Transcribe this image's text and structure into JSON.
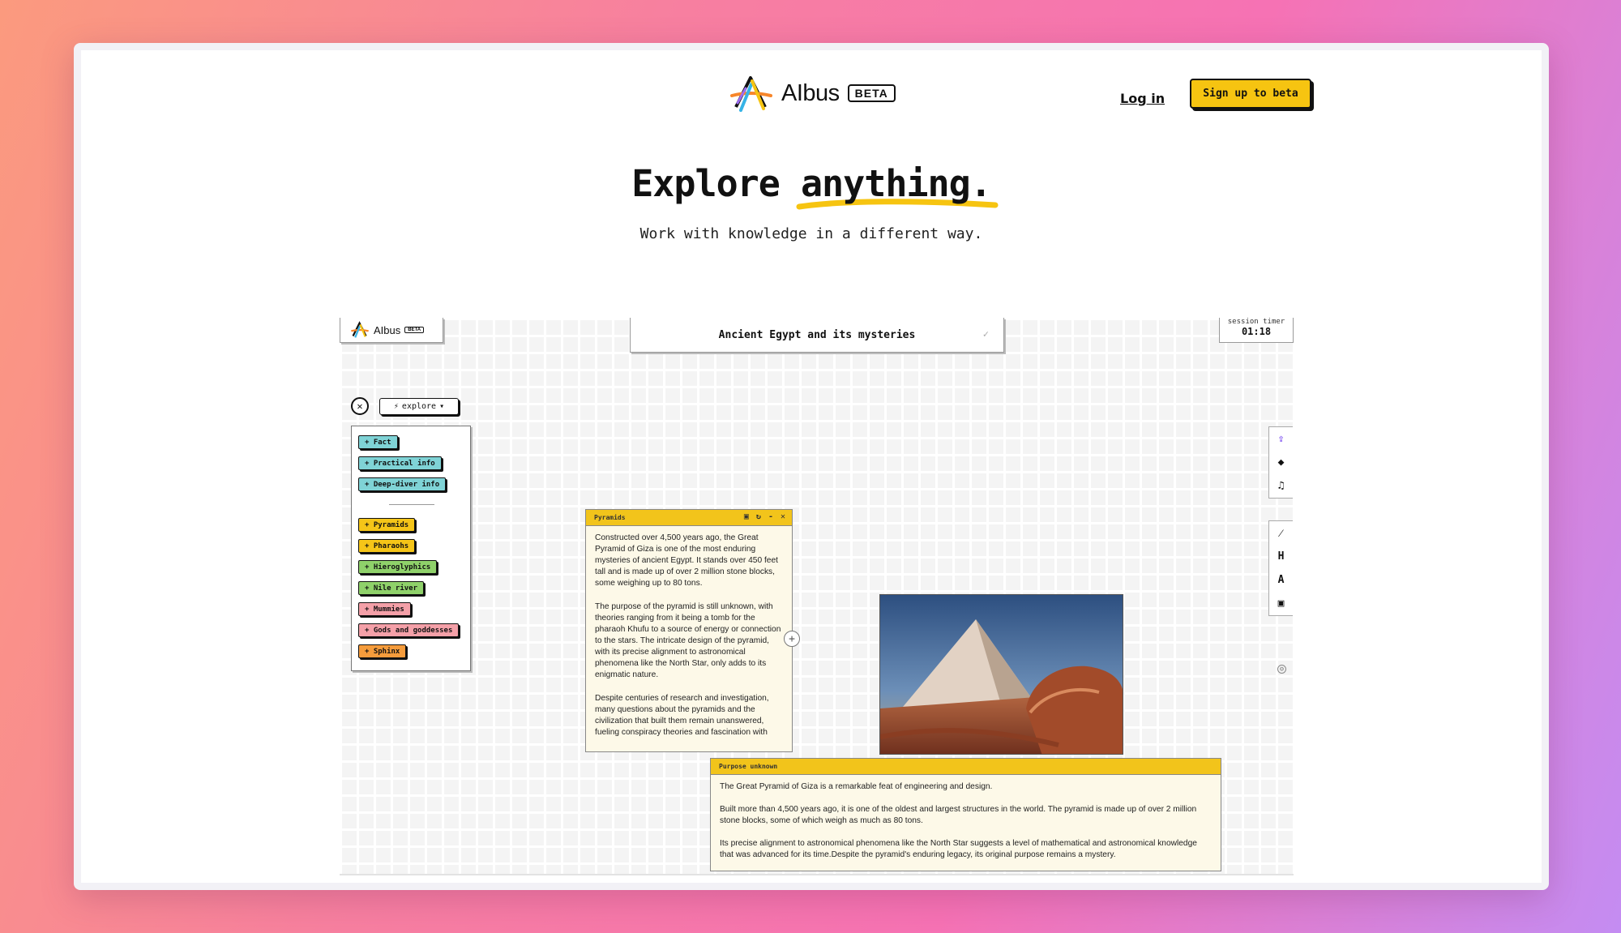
{
  "header": {
    "logo_text": "AIbus",
    "beta_label": "BETA",
    "login_label": "Log in",
    "signup_label": "Sign up to beta"
  },
  "hero": {
    "title_prefix": "Explore",
    "title_highlight": "anything.",
    "subtitle": "Work with knowledge in a different way."
  },
  "app": {
    "logo_text": "AIbus",
    "beta_label": "BETA",
    "topic": "Ancient Egypt and its mysteries",
    "timer_label": "session timer",
    "timer_value": "01:18",
    "explore_label": "explore",
    "chips": [
      {
        "label": "+ Fact",
        "color": "#7fd3d6"
      },
      {
        "label": "+ Practical info",
        "color": "#7fd3d6"
      },
      {
        "label": "+ Deep-diver info",
        "color": "#7fd3d6"
      },
      {
        "label": "+ Pyramids",
        "color": "#f5c518"
      },
      {
        "label": "+ Pharaohs",
        "color": "#f5c518"
      },
      {
        "label": "+ Hieroglyphics",
        "color": "#8fd16a"
      },
      {
        "label": "+ Nile river",
        "color": "#8fd16a"
      },
      {
        "label": "+ Mummies",
        "color": "#f4a0a8"
      },
      {
        "label": "+ Gods and goddesses",
        "color": "#f4a0a8"
      },
      {
        "label": "+ Sphinx",
        "color": "#f59c3c"
      }
    ],
    "card_pyramids": {
      "title": "Pyramids",
      "paragraphs": [
        "Constructed over 4,500 years ago, the Great Pyramid of Giza is one of the most enduring mysteries of ancient Egypt. It stands over 450 feet tall and is made up of over 2 million stone blocks, some weighing up to 80 tons.",
        "The purpose of the pyramid is still unknown, with theories ranging from it being a tomb for the pharaoh Khufu to a source of energy or connection to the stars. The intricate design of the pyramid, with its precise alignment to astronomical phenomena like the North Star, only adds to its enigmatic nature.",
        "Despite centuries of research and investigation, many questions about the pyramids and the civilization that built them remain unanswered, fueling conspiracy theories and fascination with"
      ]
    },
    "card_purpose": {
      "title": "Purpose unknown",
      "paragraphs": [
        "The Great Pyramid of Giza is a remarkable feat of engineering and design.",
        "Built more than 4,500 years ago, it is one of the oldest and largest structures in the world. The pyramid is made up of over 2 million stone blocks, some of which weigh as much as 80 tons.",
        "Its precise alignment to astronomical phenomena like the North Star suggests a level of mathematical and astronomical knowledge that was advanced for its time.Despite the pyramid's enduring legacy, its original purpose remains a mystery."
      ]
    },
    "toolbar_icons": [
      "share-icon",
      "eraser-icon",
      "music-icon",
      "magic-wand-icon",
      "heading-icon",
      "text-icon",
      "image-icon"
    ],
    "toolbar_glyphs": {
      "heading": "H",
      "text": "A"
    }
  },
  "colors": {
    "accent_yellow": "#f6c411",
    "card_header": "#f2c41b",
    "card_body": "#fdf9e8"
  }
}
